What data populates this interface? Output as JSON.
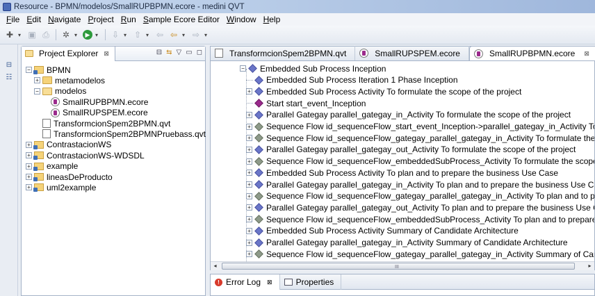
{
  "window": {
    "title": "Resource - BPMN/modelos/SmallRUPBPMN.ecore - medini QVT"
  },
  "menu": [
    "File",
    "Edit",
    "Navigate",
    "Project",
    "Run",
    "Sample Ecore Editor",
    "Window",
    "Help"
  ],
  "explorer": {
    "tab_label": "Project Explorer",
    "close_glyph": "⊠",
    "tree": [
      {
        "label": "BPMN",
        "icon": "project-icon",
        "depth": 0,
        "twist": "−"
      },
      {
        "label": "metamodelos",
        "icon": "folder-icon",
        "depth": 1,
        "twist": "+"
      },
      {
        "label": "modelos",
        "icon": "folder-icon",
        "depth": 1,
        "twist": "−"
      },
      {
        "label": "SmallRUPBPMN.ecore",
        "icon": "ecore-file-icon",
        "depth": 2,
        "twist": ""
      },
      {
        "label": "SmallRUPSPEM.ecore",
        "icon": "ecore-file-icon",
        "depth": 2,
        "twist": ""
      },
      {
        "label": "TransformcionSpem2BPMN.qvt",
        "icon": "qvt-file-icon",
        "depth": 1,
        "twist": ""
      },
      {
        "label": "TransformcionSpem2BPMNPruebass.qvt",
        "icon": "qvt-file-icon",
        "depth": 1,
        "twist": ""
      },
      {
        "label": "ContrastacionWS",
        "icon": "project-icon",
        "depth": 0,
        "twist": "+"
      },
      {
        "label": "ContrastacionWS-WDSDL",
        "icon": "project-icon",
        "depth": 0,
        "twist": "+"
      },
      {
        "label": "example",
        "icon": "project-icon",
        "depth": 0,
        "twist": "+"
      },
      {
        "label": "lineasDeProducto",
        "icon": "project-icon",
        "depth": 0,
        "twist": "+"
      },
      {
        "label": "uml2example",
        "icon": "project-icon",
        "depth": 0,
        "twist": "+"
      }
    ]
  },
  "editor": {
    "tabs": [
      {
        "label": "TransformcionSpem2BPMN.qvt",
        "active": false
      },
      {
        "label": "SmallRUPSPEM.ecore",
        "active": false
      },
      {
        "label": "SmallRUPBPMN.ecore",
        "active": true
      }
    ],
    "tree": [
      {
        "label": "Embedded Sub Process Inception",
        "kind": "node",
        "depth": 0,
        "twist": "−"
      },
      {
        "label": "Embedded Sub Process Iteration 1 Phase Inception",
        "kind": "node",
        "depth": 1,
        "twist": ""
      },
      {
        "label": "Embedded Sub Process Activity To formulate the scope of the project",
        "kind": "node",
        "depth": 1,
        "twist": "+"
      },
      {
        "label": "Start start_event_Inception",
        "kind": "start",
        "depth": 1,
        "twist": ""
      },
      {
        "label": "Parallel Gategay parallel_gategay_in_Activity To formulate the scope of the project",
        "kind": "node",
        "depth": 1,
        "twist": "+"
      },
      {
        "label": "Sequence Flow id_sequenceFlow_start_event_Inception->parallel_gategay_in_Activity To formulat",
        "kind": "flow",
        "depth": 1,
        "twist": "+"
      },
      {
        "label": "Sequence Flow id_sequenceFlow_gategay_parallel_gategay_in_Activity To formulate the scope of",
        "kind": "flow",
        "depth": 1,
        "twist": "+"
      },
      {
        "label": "Parallel Gategay parallel_gategay_out_Activity To formulate the scope of the project",
        "kind": "node",
        "depth": 1,
        "twist": "+"
      },
      {
        "label": "Sequence Flow id_sequenceFlow_embeddedSubProcess_Activity To formulate the scope of the pr",
        "kind": "flow",
        "depth": 1,
        "twist": "+"
      },
      {
        "label": "Embedded Sub Process Activity To plan and to prepare the business Use Case",
        "kind": "node",
        "depth": 1,
        "twist": "+"
      },
      {
        "label": "Parallel Gategay parallel_gategay_in_Activity To plan and to prepare the business Use Case",
        "kind": "node",
        "depth": 1,
        "twist": "+"
      },
      {
        "label": "Sequence Flow id_sequenceFlow_gategay_parallel_gategay_in_Activity To plan and to prepare the",
        "kind": "flow",
        "depth": 1,
        "twist": "+"
      },
      {
        "label": "Parallel Gategay parallel_gategay_out_Activity To plan and to prepare the business Use Case",
        "kind": "node",
        "depth": 1,
        "twist": "+"
      },
      {
        "label": "Sequence Flow id_sequenceFlow_embeddedSubProcess_Activity To plan and to prepare the busi",
        "kind": "flow",
        "depth": 1,
        "twist": "+"
      },
      {
        "label": "Embedded Sub Process Activity Summary of Candidate Architecture",
        "kind": "node",
        "depth": 1,
        "twist": "+"
      },
      {
        "label": "Parallel Gategay parallel_gategay_in_Activity Summary of Candidate Architecture",
        "kind": "node",
        "depth": 1,
        "twist": "+"
      },
      {
        "label": "Sequence Flow id_sequenceFlow_gategay_parallel_gategay_in_Activity Summary of Candidate Ar",
        "kind": "flow",
        "depth": 1,
        "twist": "+"
      },
      {
        "label": "Parallel Gategay parallel_gategay_out_Activity Summary of Candidate Architecture",
        "kind": "node",
        "depth": 1,
        "twist": "+"
      }
    ],
    "scroll_grip": "III"
  },
  "bottom": {
    "tabs": [
      {
        "label": "Error Log",
        "icon": "error-log-icon",
        "active": true
      },
      {
        "label": "Properties",
        "icon": "properties-icon",
        "active": false
      }
    ]
  }
}
